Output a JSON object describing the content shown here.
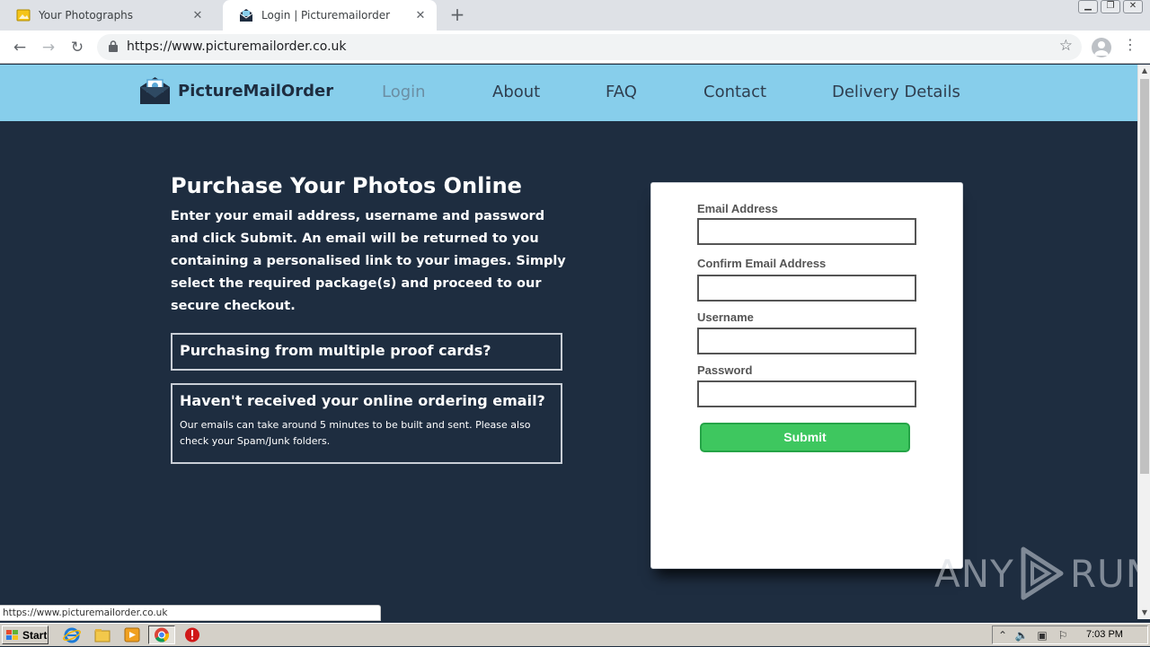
{
  "browser": {
    "tabs": [
      {
        "title": "Your Photographs",
        "active": false
      },
      {
        "title": "Login | Picturemailorder",
        "active": true
      }
    ],
    "new_tab": "+",
    "url": "https://www.picturemailorder.co.uk",
    "status_url": "https://www.picturemailorder.co.uk"
  },
  "site": {
    "brand": "PictureMailOrder",
    "nav": [
      "Login",
      "About",
      "FAQ",
      "Contact",
      "Delivery Details"
    ],
    "hero_title": "Purchase Your Photos Online",
    "hero_text": "Enter your email address, username and password and click Submit.  An email will be returned to you containing a personalised link to your images. Simply select the required package(s) and proceed to our secure checkout.",
    "info_boxes": [
      {
        "title": "Purchasing from multiple proof cards?"
      },
      {
        "title": "Haven't received your online ordering email?",
        "body": "Our emails can take around 5 minutes to be built and sent. Please also check your Spam/Junk folders."
      }
    ],
    "form": {
      "email_label": "Email Address",
      "email_value": "",
      "confirm_label": "Confirm Email Address",
      "confirm_value": "",
      "username_label": "Username",
      "username_value": "",
      "password_label": "Password",
      "password_value": "",
      "submit_label": "Submit"
    }
  },
  "watermark": {
    "left": "ANY",
    "right": "RUN"
  },
  "taskbar": {
    "start_label": "Start",
    "clock": "7:03 PM",
    "apps": [
      "internet-explorer-icon",
      "file-explorer-icon",
      "media-player-icon",
      "chrome-icon",
      "stop-icon"
    ]
  },
  "colors": {
    "header_bg": "#87ceeb",
    "page_bg": "#1e2d40",
    "submit_bg": "#3ec75f"
  }
}
